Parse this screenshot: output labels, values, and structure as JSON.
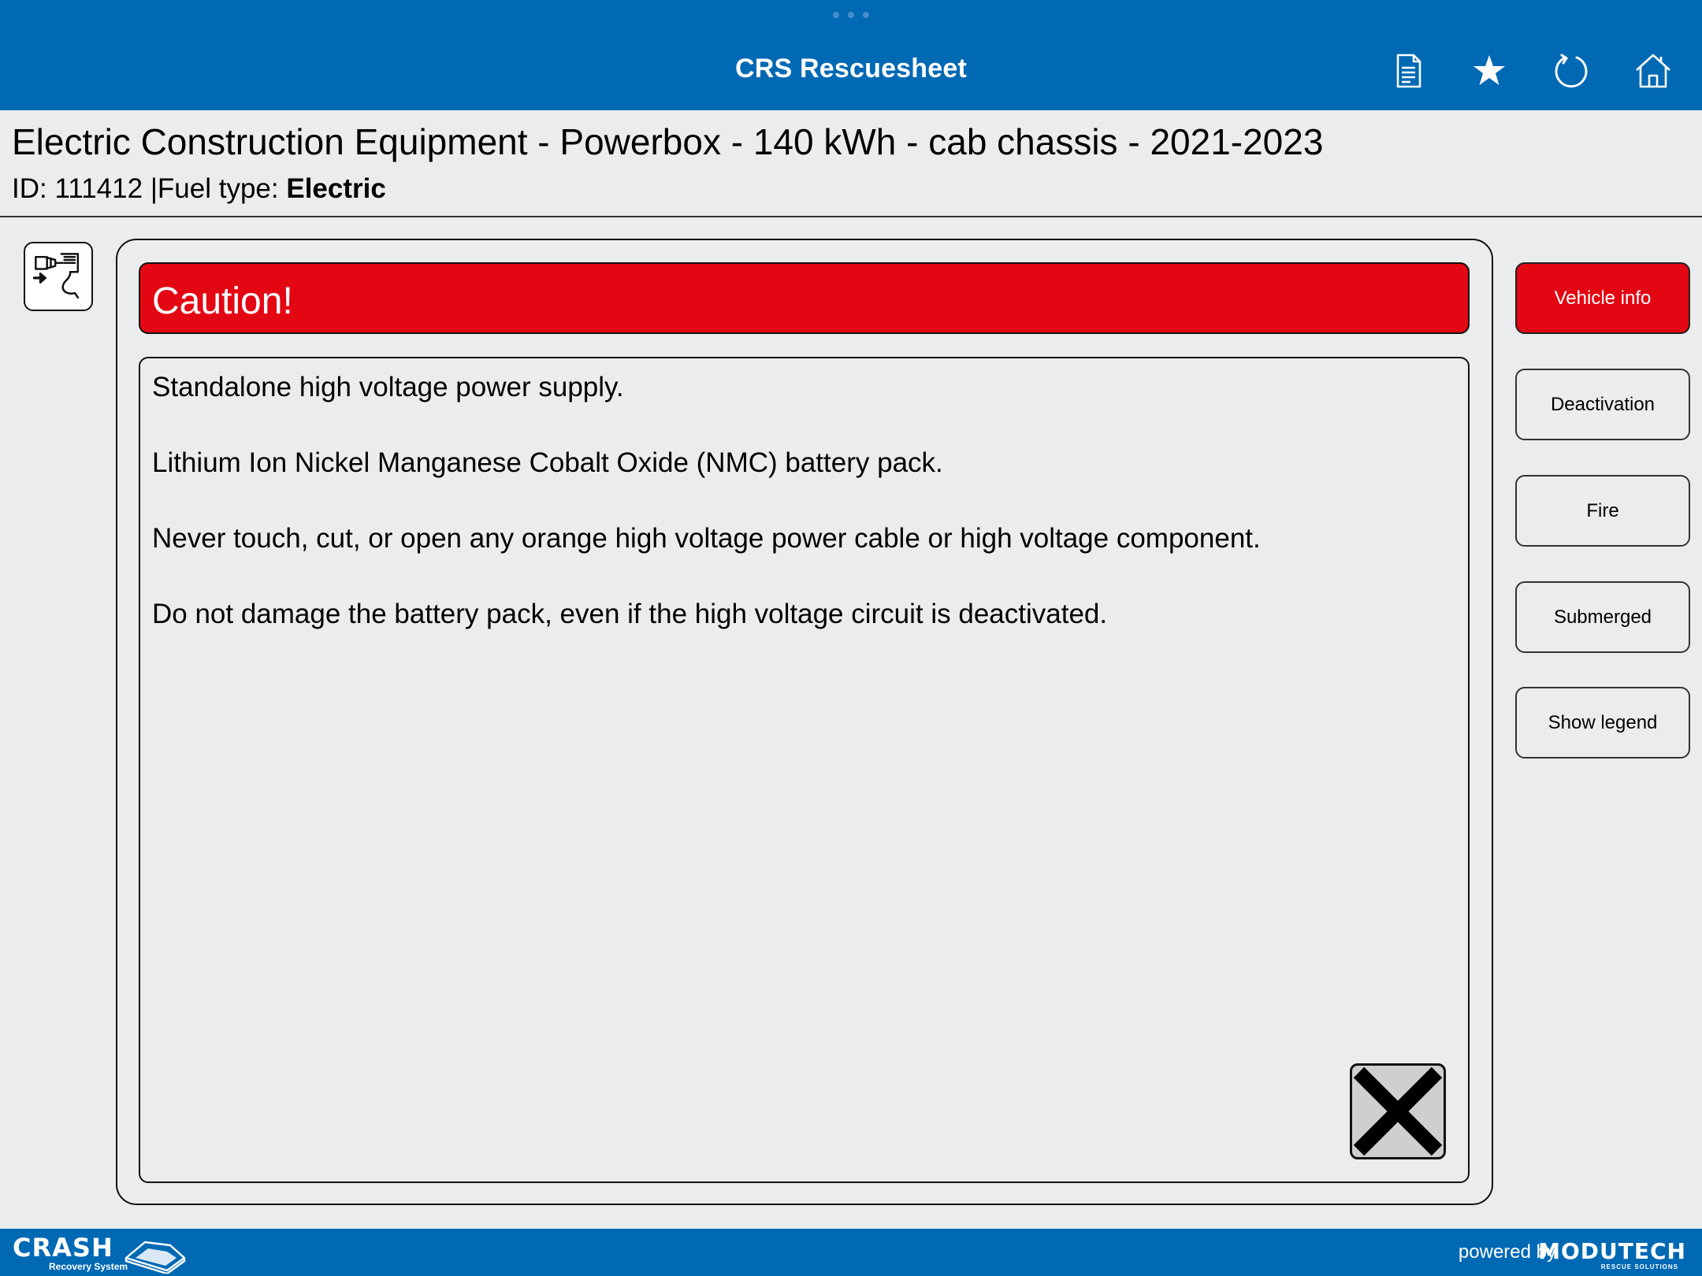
{
  "app": {
    "title": "CRS Rescuesheet",
    "toolbar_icons": [
      "document-icon",
      "star-icon",
      "refresh-icon",
      "home-icon"
    ]
  },
  "vehicle": {
    "title": "Electric Construction Equipment - Powerbox - 140 kWh - cab chassis - 2021-2023",
    "id_label": "ID:",
    "id_value": "111412",
    "separator": "|",
    "fuel_label": "Fuel type:",
    "fuel_value": "Electric",
    "fuel_icon": "electric-plug-icon"
  },
  "caution": {
    "heading": "Caution!",
    "lines": [
      "Standalone high voltage power supply.",
      "Lithium Ion Nickel Manganese Cobalt Oxide (NMC) battery pack.",
      "Never touch, cut, or open any orange high voltage power cable or high voltage component.",
      "Do not damage the battery pack, even if the high voltage circuit is deactivated."
    ]
  },
  "side_buttons": [
    {
      "label": "Vehicle info",
      "active": true
    },
    {
      "label": "Deactivation",
      "active": false
    },
    {
      "label": "Fire",
      "active": false
    },
    {
      "label": "Submerged",
      "active": false
    },
    {
      "label": "Show legend",
      "active": false
    }
  ],
  "footer": {
    "brand_word": "CRASH",
    "brand_sub": "Recovery System",
    "powered_by": "powered by",
    "partner_word": "MODUTECH",
    "partner_sub": "RESCUE SOLUTIONS"
  },
  "colors": {
    "primary_blue": "#0069b4",
    "caution_red": "#e30613",
    "background": "#ebeced"
  }
}
